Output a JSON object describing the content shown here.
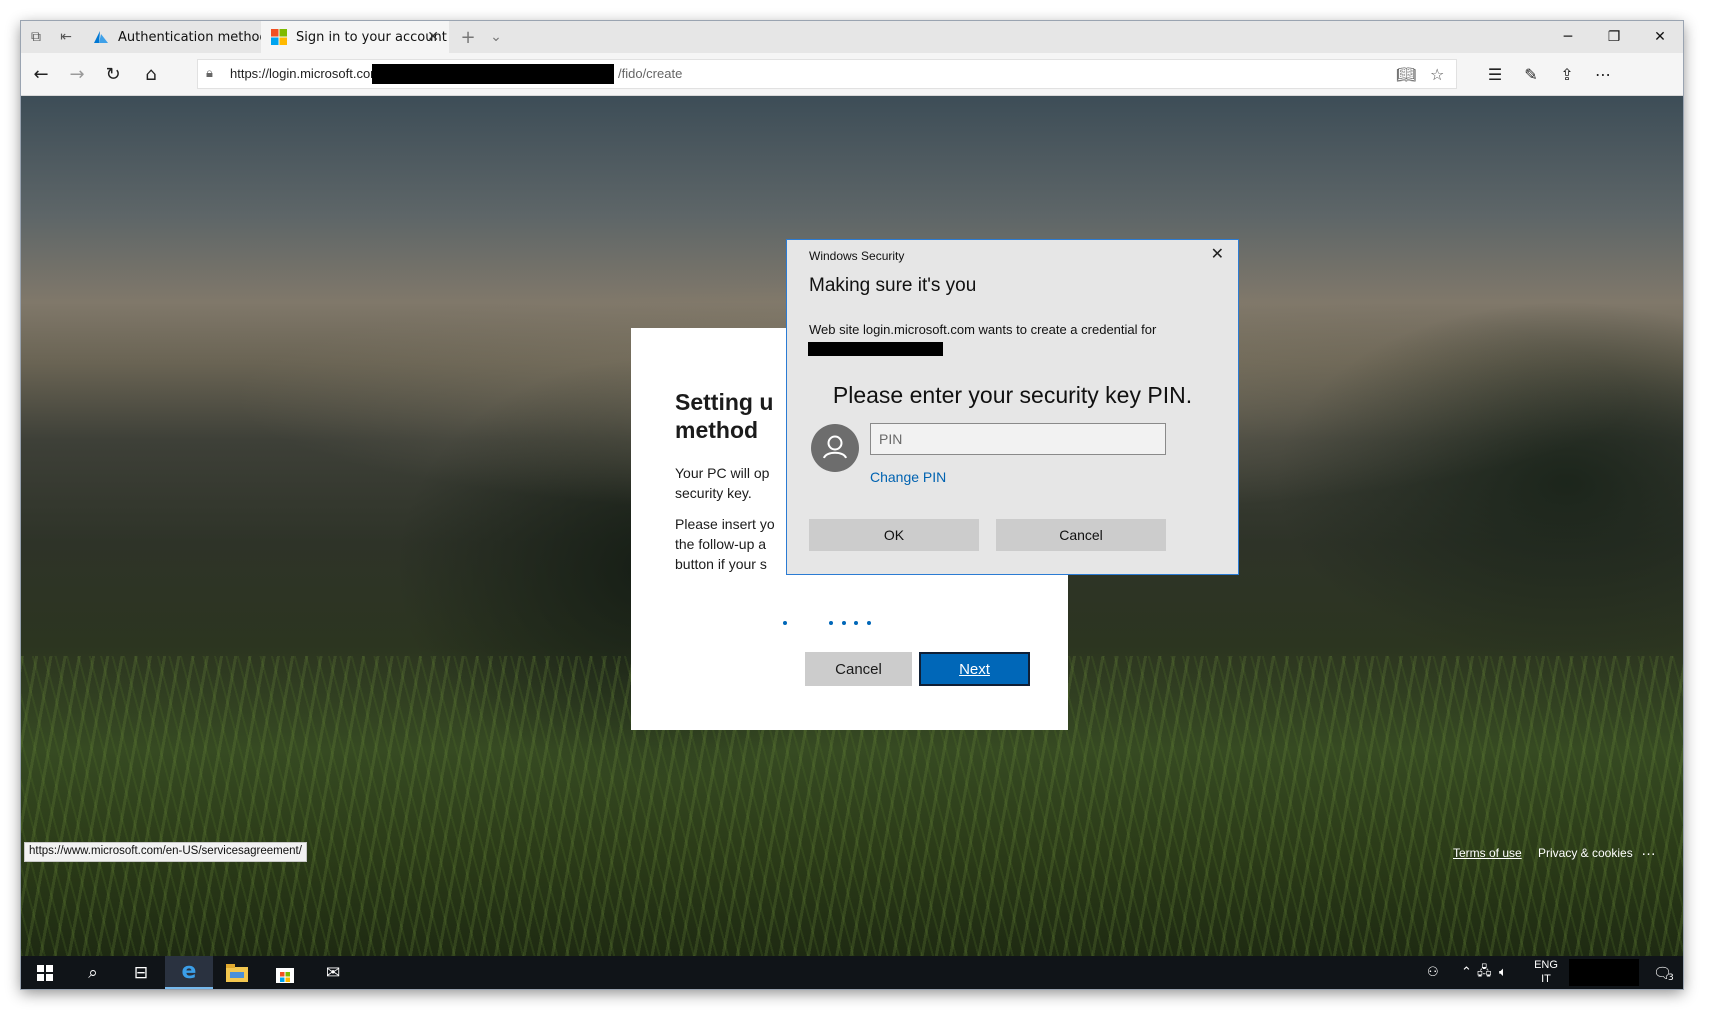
{
  "browser": {
    "tabs": [
      {
        "title": "Authentication methods - A"
      },
      {
        "title": "Sign in to your account"
      }
    ],
    "url_prefix": "https://login.microsoft.com/",
    "url_suffix": "/fido/create",
    "status_url": "https://www.microsoft.com/en-US/servicesagreement/"
  },
  "page": {
    "title": "Setting up method",
    "title_line1": "Setting u",
    "title_line2": "method",
    "para1_line1": "Your PC will op",
    "para1_line2": "security key.",
    "para2_line1": "Please insert yo",
    "para2_line2": "the follow-up a",
    "para2_line3": "button if your s",
    "cancel_label": "Cancel",
    "next_label": "Next",
    "footer": {
      "terms": "Terms of use",
      "privacy": "Privacy & cookies",
      "more": "…"
    }
  },
  "dialog": {
    "caption": "Windows Security",
    "heading": "Making sure it's you",
    "message": "Web site login.microsoft.com wants to create a credential for",
    "prompt": "Please enter your security key PIN.",
    "pin_placeholder": "PIN",
    "change_pin": "Change PIN",
    "ok_label": "OK",
    "cancel_label": "Cancel"
  },
  "taskbar": {
    "lang_line1": "ENG",
    "lang_line2": "IT",
    "notification_count": "3"
  },
  "colors": {
    "accent": "#0067b8",
    "link": "#0063b1",
    "dialog_border": "#2b7bd3"
  }
}
